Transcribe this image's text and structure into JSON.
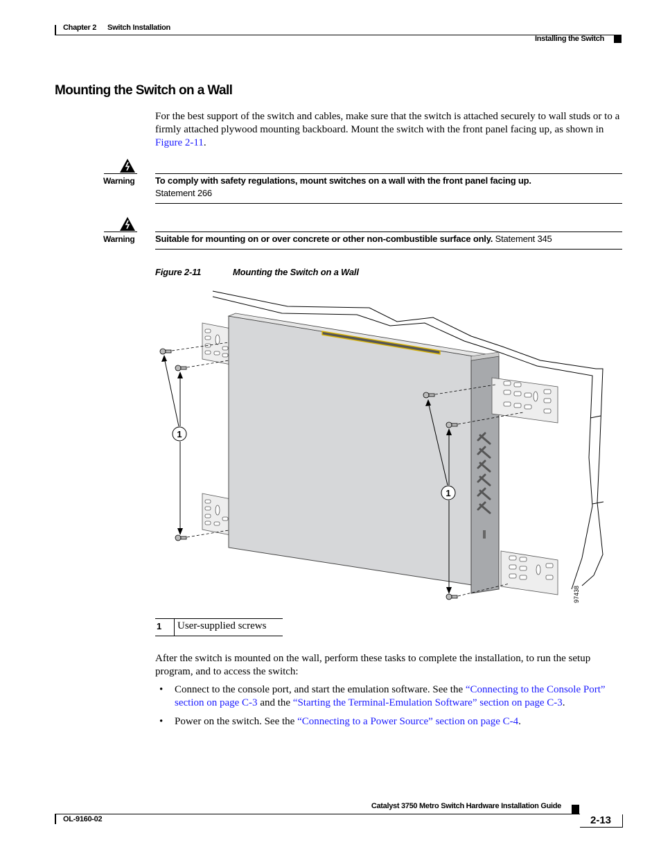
{
  "header": {
    "chapter_label": "Chapter 2",
    "chapter_title": "Switch Installation",
    "section_title": "Installing the Switch"
  },
  "heading": "Mounting the Switch on a Wall",
  "intro": {
    "text_before": "For the best support of the switch and cables, make sure that the switch is attached securely to wall studs or to a firmly attached plywood mounting backboard. Mount the switch with the front panel facing up, as shown in ",
    "link": "Figure 2-11",
    "text_after": "."
  },
  "warnings": [
    {
      "icon": "warning-lightning-triangle-icon",
      "label": "Warning",
      "bold_text": "To comply with safety regulations, mount switches on a wall with the front panel facing up.",
      "statement": "Statement 266"
    },
    {
      "icon": "warning-lightning-triangle-icon",
      "label": "Warning",
      "bold_text": "Suitable for mounting on or over concrete or other non-combustible surface only.",
      "statement": "Statement 345"
    }
  ],
  "figure": {
    "number": "Figure 2-11",
    "title": "Mounting the Switch on a Wall",
    "callouts": [
      "1",
      "1"
    ],
    "art_id": "97438",
    "accent_color": "#d9b300",
    "switch_color": "#d6d7d9"
  },
  "legend": [
    {
      "num": "1",
      "text": "User-supplied screws"
    }
  ],
  "after": {
    "text": "After the switch is mounted on the wall, perform these tasks to complete the installation, to run the setup program, and to access the switch:"
  },
  "bullets": [
    {
      "parts": [
        {
          "t": "Connect to the console port, and start the emulation software. See the ",
          "link": false
        },
        {
          "t": "“Connecting to the Console Port” section on page C-3",
          "link": true
        },
        {
          "t": " and the ",
          "link": false
        },
        {
          "t": "“Starting the Terminal-Emulation Software” section on page C-3",
          "link": true
        },
        {
          "t": ".",
          "link": false
        }
      ]
    },
    {
      "parts": [
        {
          "t": "Power on the switch. See the ",
          "link": false
        },
        {
          "t": "“Connecting to a Power Source” section on page C-4",
          "link": true
        },
        {
          "t": ".",
          "link": false
        }
      ]
    }
  ],
  "footer": {
    "guide_title": "Catalyst 3750 Metro Switch Hardware Installation Guide",
    "doc_number": "OL-9160-02",
    "page_number": "2-13"
  }
}
